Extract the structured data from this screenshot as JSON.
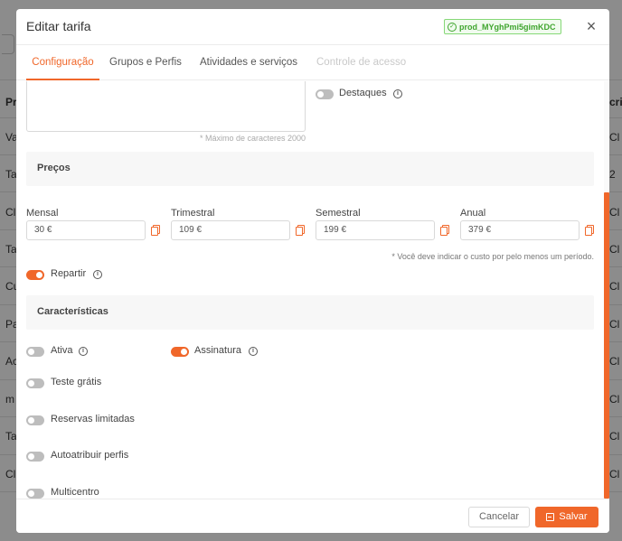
{
  "background": {
    "left_cells": [
      "Pr",
      "Va",
      "Ta",
      "Cl",
      "Ta",
      "Cu",
      "Pa",
      "Ac",
      "m",
      "Ta",
      "Cl"
    ],
    "right_cells": [
      "cri",
      "Cl",
      "2",
      "Cl",
      "Cl",
      "Cl",
      "Cl",
      "Cl",
      "Cl",
      "Cl",
      "Cl"
    ]
  },
  "modal": {
    "title": "Editar tarifa",
    "product_id": "prod_MYghPmi5gimKDC",
    "close_label": "×"
  },
  "tabs": [
    {
      "label": "Configuração",
      "state": "active"
    },
    {
      "label": "Grupos e Perfis",
      "state": "normal"
    },
    {
      "label": "Atividades e serviços",
      "state": "normal"
    },
    {
      "label": "Controle de acesso",
      "state": "disabled"
    }
  ],
  "description": {
    "value": "",
    "char_hint": "* Máximo de caracteres 2000"
  },
  "highlights": {
    "label": "Destaques",
    "enabled": false
  },
  "prices": {
    "section_title": "Preços",
    "fields": [
      {
        "label": "Mensal",
        "value": "30 €"
      },
      {
        "label": "Trimestral",
        "value": "109 €"
      },
      {
        "label": "Semestral",
        "value": "199 €"
      },
      {
        "label": "Anual",
        "value": "379 €"
      }
    ],
    "hint": "* Você deve indicar o custo por pelo menos um período.",
    "split": {
      "label": "Repartir",
      "enabled": true
    }
  },
  "features": {
    "section_title": "Características",
    "active": {
      "label": "Ativa",
      "enabled": false
    },
    "subscription": {
      "label": "Assinatura",
      "enabled": true
    },
    "free_trial": {
      "label": "Teste grátis",
      "enabled": false
    },
    "limited_bookings": {
      "label": "Reservas limitadas",
      "enabled": false
    },
    "auto_assign_profiles": {
      "label": "Autoatribuir perfis",
      "enabled": false
    },
    "multicenter": {
      "label": "Multicentro",
      "enabled": false
    }
  },
  "footer": {
    "cancel_label": "Cancelar",
    "save_label": "Salvar"
  },
  "colors": {
    "accent": "#f0672a",
    "badge_green": "#3fa52e",
    "toggle_off": "#bdbdbd"
  }
}
